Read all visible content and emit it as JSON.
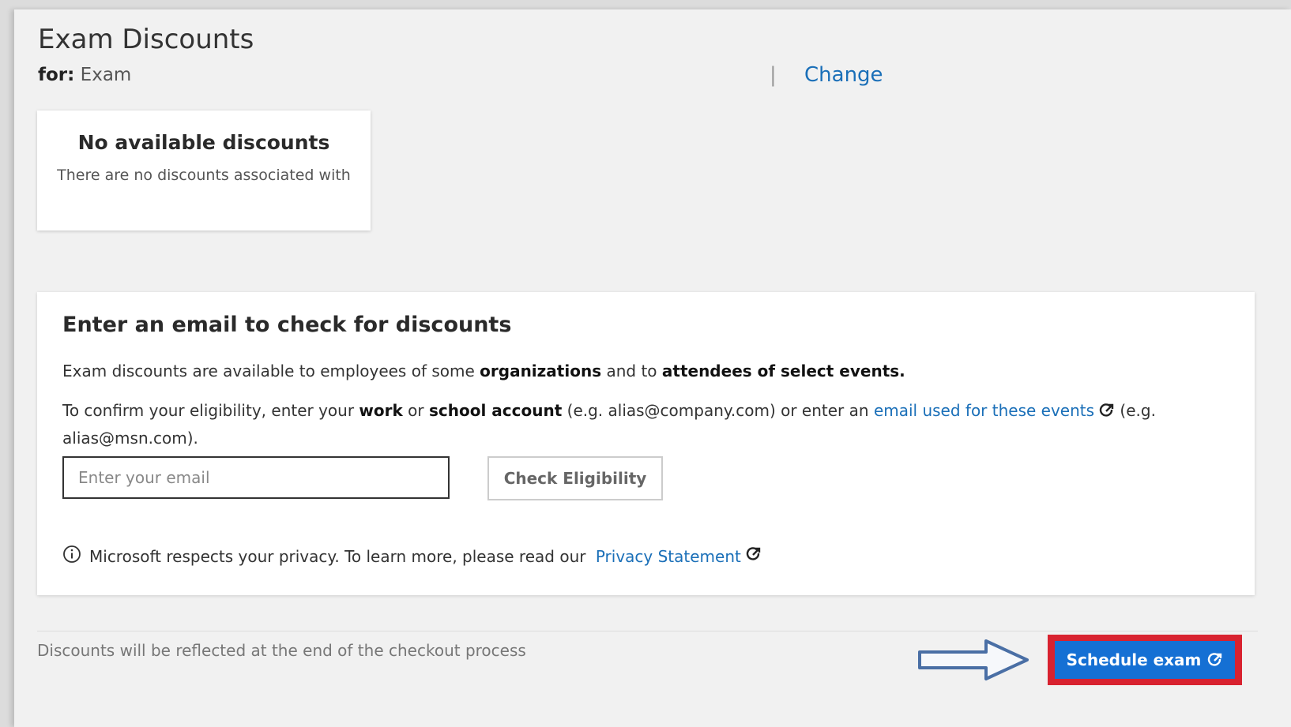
{
  "header": {
    "title": "Exam Discounts",
    "for_label": "for:",
    "for_value": "Exam",
    "pipe": "|",
    "change_link": "Change"
  },
  "discount_card": {
    "heading": "No available discounts",
    "body": "There are no discounts associated with"
  },
  "email_card": {
    "heading": "Enter an email to check for discounts",
    "p1": {
      "t1": "Exam discounts are available to employees of some ",
      "b1": "organizations",
      "t2": " and to ",
      "b2": "attendees of select events."
    },
    "p2": {
      "t1": "To confirm your eligibility, enter your ",
      "b1": "work",
      "t2": " or ",
      "b2": "school account",
      "t3": " (e.g. alias@company.com) or enter an ",
      "link": "email used for these events",
      "t4": " (e.g. alias@msn.com)."
    },
    "email_placeholder": "Enter your email",
    "check_button": "Check Eligibility",
    "privacy_text": "Microsoft respects your privacy. To learn more, please read our ",
    "privacy_link": "Privacy Statement"
  },
  "footer": {
    "note": "Discounts will be reflected at the end of the checkout process",
    "schedule_button": "Schedule exam"
  },
  "colors": {
    "link": "#1a6fb8",
    "primary_button": "#1570d4",
    "highlight_border": "#d8222f",
    "arrow": "#4a6fa5"
  },
  "icons": [
    "external-link-icon",
    "info-icon",
    "arrow-right-icon"
  ]
}
